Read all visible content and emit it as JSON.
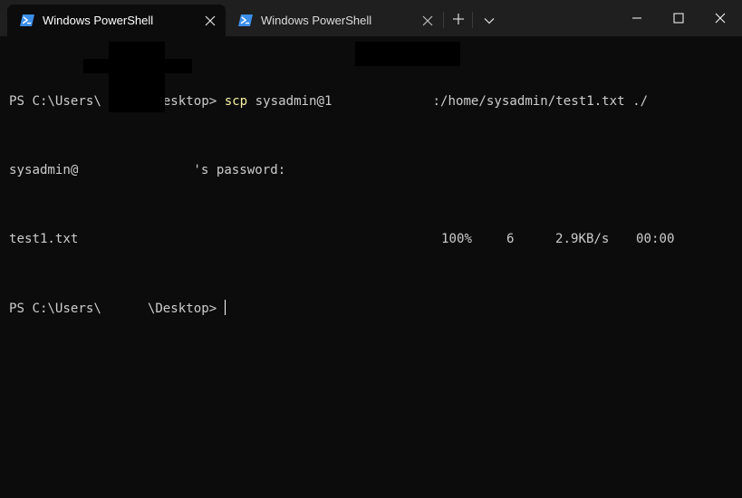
{
  "tabs": [
    {
      "title": "Windows PowerShell",
      "active": true
    },
    {
      "title": "Windows PowerShell",
      "active": false
    }
  ],
  "toolbar": {
    "new_tab_icon": "plus-icon",
    "dropdown_icon": "chevron-down-icon"
  },
  "window_controls": {
    "minimize_icon": "minimize-icon",
    "maximize_icon": "maximize-icon",
    "close_icon": "close-icon"
  },
  "terminal": {
    "line1": {
      "prompt_prefix": "PS C:\\Users\\",
      "prompt_suffix": "\\Desktop> ",
      "command": "scp",
      "arg_prefix": " sysadmin@1",
      "arg_suffix": ":/home/sysadmin/test1.txt ./"
    },
    "line2": {
      "user_prefix": "sysadmin@",
      "password_suffix": "'s password:"
    },
    "line3": {
      "file": "test1.txt",
      "percent": "100%",
      "size": "6",
      "rate": "2.9KB/s",
      "eta": "00:00"
    },
    "line4": {
      "prompt_prefix": "PS C:\\Users\\",
      "prompt_suffix": "\\Desktop> "
    }
  },
  "colors": {
    "background": "#0c0c0c",
    "tabbar": "#1f1f1f",
    "text": "#cccccc",
    "command": "#f9f1a5",
    "ps_icon": "#3b8eea"
  }
}
